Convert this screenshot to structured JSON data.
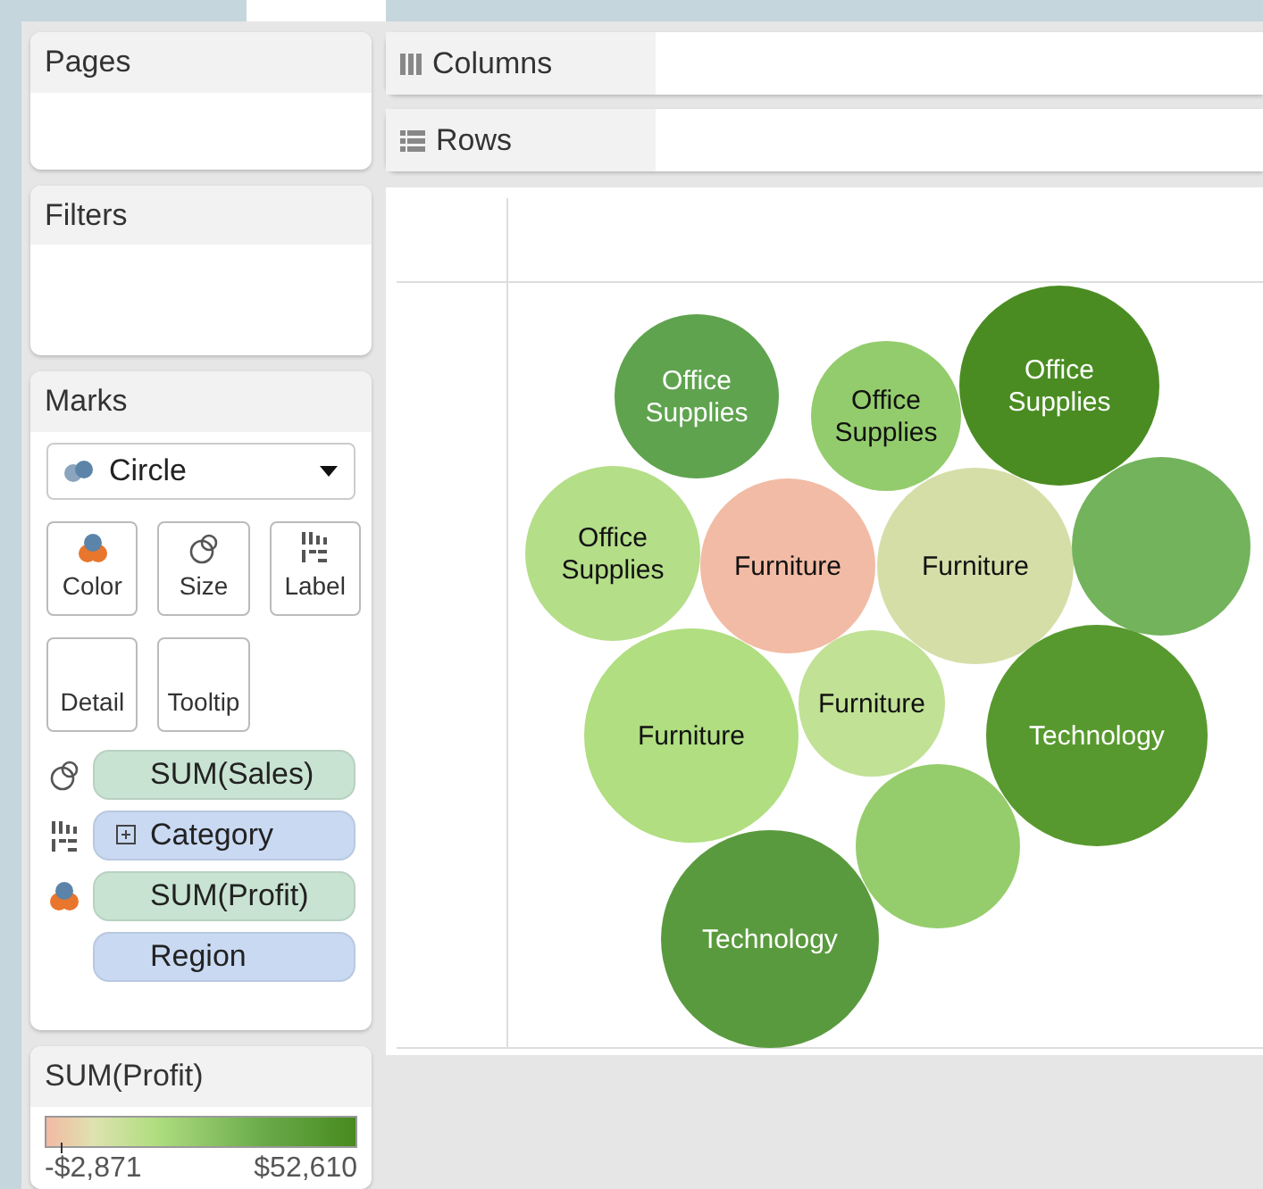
{
  "cards": {
    "pages": "Pages",
    "filters": "Filters",
    "marks": "Marks"
  },
  "shelves": [
    {
      "kind": "columns",
      "label": "Columns"
    },
    {
      "kind": "rows",
      "label": "Rows"
    }
  ],
  "mark_type": {
    "label": "Circle"
  },
  "mark_buttons": [
    {
      "kind": "color",
      "label": "Color"
    },
    {
      "kind": "size",
      "label": "Size"
    },
    {
      "kind": "label",
      "label": "Label"
    },
    {
      "kind": "detail",
      "label": "Detail"
    },
    {
      "kind": "tooltip",
      "label": "Tooltip"
    }
  ],
  "pills": [
    {
      "kind": "size",
      "color": "#c8e3d2",
      "label": "SUM(Sales)",
      "expandable": false
    },
    {
      "kind": "label",
      "color": "#c9d9f2",
      "label": "Category",
      "expandable": true
    },
    {
      "kind": "color",
      "color": "#c8e3d2",
      "label": "SUM(Profit)",
      "expandable": false
    },
    {
      "kind": "none",
      "color": "#c9d9f2",
      "label": "Region",
      "expandable": false
    }
  ],
  "bubbles": [
    {
      "label": "Office Supplies",
      "color": "#5fa34f"
    },
    {
      "label": "Office Supplies",
      "color": "#93cc6c"
    },
    {
      "label": "Office Supplies",
      "color": "#4a8c22"
    },
    {
      "label": "Office Supplies",
      "color": "#b4de88"
    },
    {
      "label": "Furniture",
      "color": "#f2bba5"
    },
    {
      "label": "Furniture",
      "color": "#d6dea8"
    },
    {
      "color": "#72b35c"
    },
    {
      "label": "Furniture",
      "color": "#b0de80"
    },
    {
      "label": "Furniture",
      "color": "#c1e195"
    },
    {
      "label": "Technology",
      "color": "#58992f"
    },
    {
      "color": "#96cd6c"
    },
    {
      "label": "Technology",
      "color": "#5a9a3e"
    }
  ],
  "legend": {
    "title": "SUM(Profit)",
    "min": "-$2,871",
    "max": "$52,610"
  }
}
